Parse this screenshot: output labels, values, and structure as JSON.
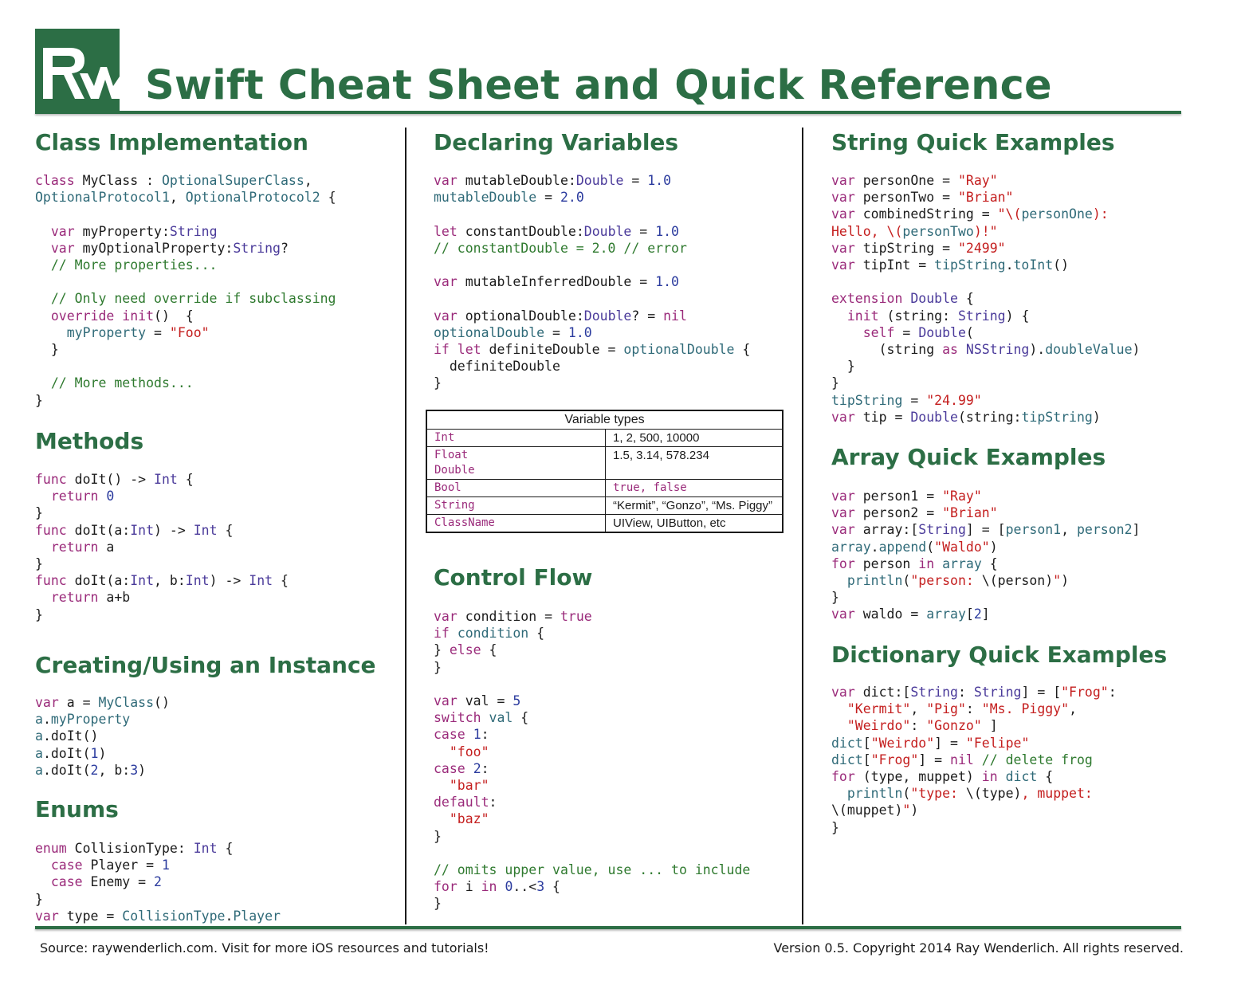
{
  "header": {
    "title": "Swift Cheat Sheet and Quick Reference",
    "logo": "raywenderlich-rw-logo",
    "brand_color": "#2c6e45"
  },
  "sections": {
    "class_impl": "Class Implementation",
    "methods": "Methods",
    "instance": "Creating/Using an Instance",
    "enums": "Enums",
    "declaring": "Declaring Variables",
    "control_flow": "Control Flow",
    "strings": "String Quick Examples",
    "arrays": "Array Quick Examples",
    "dictionaries": "Dictionary Quick Examples"
  },
  "variable_types": {
    "header": "Variable types",
    "rows": [
      {
        "type": "Int",
        "examples": "1, 2, 500, 10000"
      },
      {
        "type": "Float\nDouble",
        "examples": "1.5, 3.14, 578.234"
      },
      {
        "type": "Bool",
        "examples": "true, false"
      },
      {
        "type": "String",
        "examples": "“Kermit”, “Gonzo”, “Ms. Piggy”"
      },
      {
        "type": "ClassName",
        "examples": "UIView, UIButton, etc"
      }
    ]
  },
  "footer": {
    "source": "Source: raywenderlich.com. Visit for more iOS resources and tutorials!",
    "version": "Version 0.5. Copyright 2014 Ray Wenderlich. All rights reserved."
  },
  "colors": {
    "keyword": "#9a2a7a",
    "type": "#4a3a9a",
    "identifier": "#2f6a78",
    "string": "#c41e1e",
    "number": "#2b3b9e",
    "comment": "#2f7a2f"
  }
}
